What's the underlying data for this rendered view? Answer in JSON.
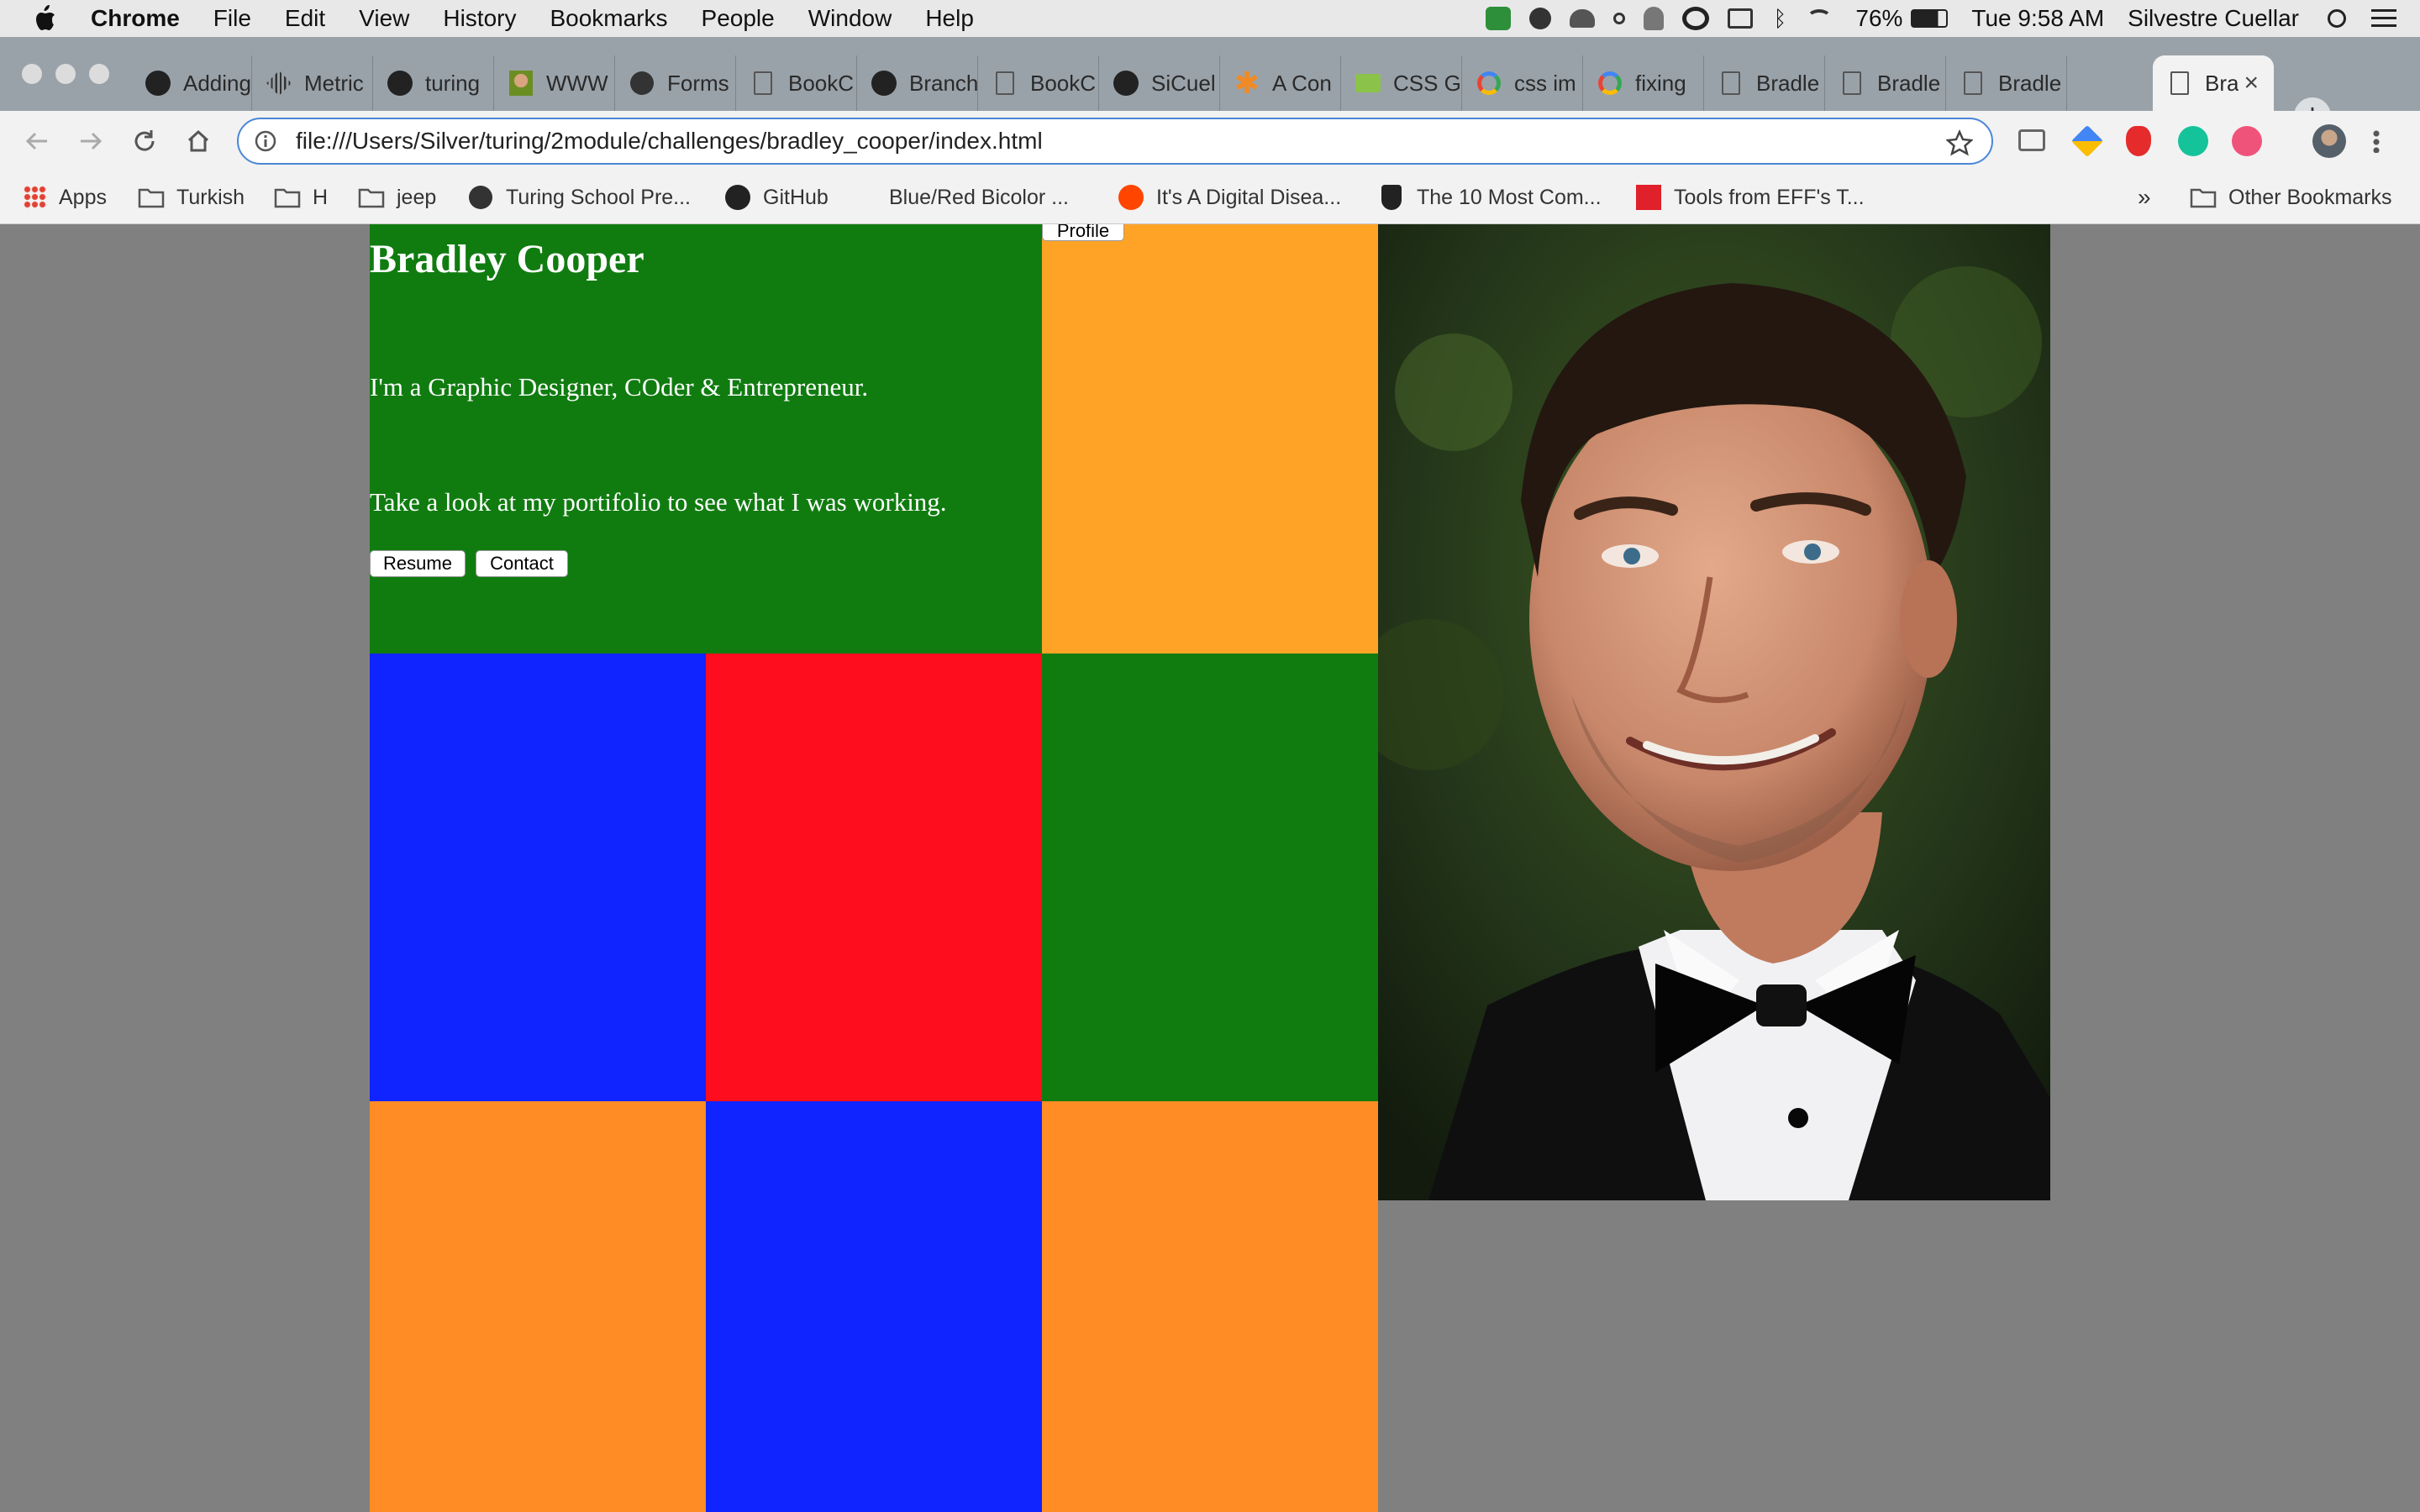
{
  "menubar": {
    "app": "Chrome",
    "items": [
      "File",
      "Edit",
      "View",
      "History",
      "Bookmarks",
      "People",
      "Window",
      "Help"
    ],
    "battery": "76%",
    "clock": "Tue 9:58 AM",
    "user": "Silvestre Cuellar"
  },
  "tabs": [
    {
      "title": "Adding",
      "icon": "github-icon"
    },
    {
      "title": "Metric",
      "icon": "grid-icon"
    },
    {
      "title": "turing",
      "icon": "github-icon"
    },
    {
      "title": "WWW",
      "icon": "avatar-icon"
    },
    {
      "title": "Forms",
      "icon": "turing-icon"
    },
    {
      "title": "BookC",
      "icon": "page-icon"
    },
    {
      "title": "Branch",
      "icon": "github-icon"
    },
    {
      "title": "BookC",
      "icon": "page-icon"
    },
    {
      "title": "SiCuel",
      "icon": "github-icon"
    },
    {
      "title": "A Con",
      "icon": "asterisk-icon"
    },
    {
      "title": "CSS G",
      "icon": "css-icon"
    },
    {
      "title": "css im",
      "icon": "google-icon"
    },
    {
      "title": "fixing",
      "icon": "google-icon"
    },
    {
      "title": "Bradle",
      "icon": "page-icon"
    },
    {
      "title": "Bradle",
      "icon": "page-icon"
    },
    {
      "title": "Bradle",
      "icon": "page-icon"
    },
    {
      "title": "Bra",
      "icon": "page-icon",
      "active": true
    }
  ],
  "address_bar": {
    "url": "file:///Users/Silver/turing/2module/challenges/bradley_cooper/index.html"
  },
  "bookmarks": {
    "items": [
      {
        "label": "Apps",
        "icon": "apps-grid-icon"
      },
      {
        "label": "Turkish",
        "icon": "folder-icon"
      },
      {
        "label": "H",
        "icon": "folder-icon"
      },
      {
        "label": "jeep",
        "icon": "folder-icon"
      },
      {
        "label": "Turing School Pre...",
        "icon": "turing-icon"
      },
      {
        "label": "GitHub",
        "icon": "github-icon"
      },
      {
        "label": "Blue/Red Bicolor ...",
        "icon": "blank-icon"
      },
      {
        "label": "It's A Digital Disea...",
        "icon": "reddit-icon"
      },
      {
        "label": "The 10 Most Com...",
        "icon": "shield-icon"
      },
      {
        "label": "Tools from EFF's T...",
        "icon": "eff-icon"
      }
    ],
    "overflow": "»",
    "other": "Other Bookmarks"
  },
  "page": {
    "name": "Bradley Cooper",
    "tagline": "I'm a Graphic Designer, COder & Entrepreneur.",
    "blurb": "Take a look at my portifolio to see what I was working.",
    "buttons": {
      "resume": "Resume",
      "contact": "Contact",
      "profile": "Profile"
    },
    "photo_alt": "Bradley Cooper in tuxedo"
  },
  "colors": {
    "green": "#107c10",
    "orange_top": "#ffa327",
    "blue": "#1024ff",
    "red": "#fd0d1d",
    "orange": "#ff8c25",
    "page_bg": "#808080"
  }
}
